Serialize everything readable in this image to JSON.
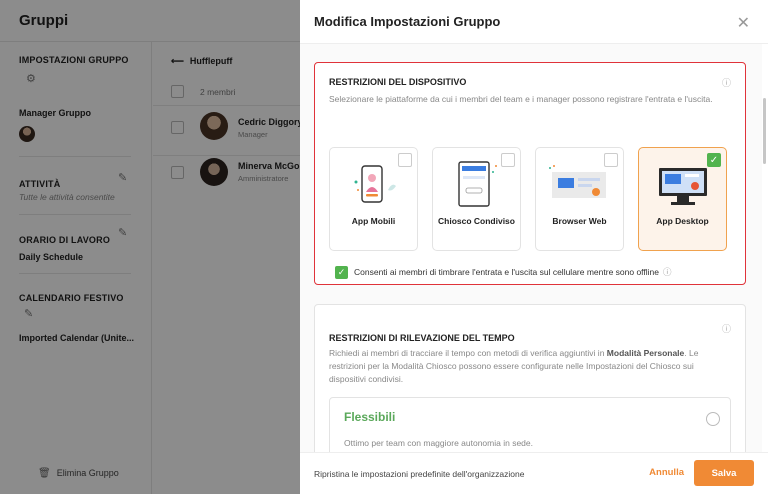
{
  "app": {
    "title": "Gruppi"
  },
  "sidebar": {
    "group_settings_heading": "IMPOSTAZIONI GRUPPO",
    "manager_label": "Manager Gruppo",
    "activities_heading": "ATTIVITÀ",
    "activities_value": "Tutte le attività consentite",
    "schedule_heading": "ORARIO DI LAVORO",
    "schedule_value": "Daily Schedule",
    "holiday_heading": "CALENDARIO FESTIVO",
    "holiday_value": "Imported Calendar (Unite...",
    "delete_label": "Elimina Gruppo"
  },
  "group": {
    "back_label": "Hufflepuff",
    "members_count": "2 membri",
    "members": [
      {
        "name": "Cedric Diggory",
        "role": "Manager"
      },
      {
        "name": "Minerva McGor",
        "role": "Amministratore"
      }
    ]
  },
  "drawer": {
    "title": "Modifica Impostazioni Gruppo",
    "device": {
      "heading": "RESTRIZIONI DEL DISPOSITIVO",
      "description": "Selezionare le piattaforme da cui i membri del team e i manager possono registrare l'entrata e l'uscita.",
      "options": [
        {
          "label": "App Mobili",
          "selected": false
        },
        {
          "label": "Chiosco Condiviso",
          "selected": false
        },
        {
          "label": "Browser Web",
          "selected": false
        },
        {
          "label": "App Desktop",
          "selected": true
        }
      ],
      "offline_label": "Consenti ai membri di timbrare l'entrata e l'uscita sul cellulare mentre sono offline",
      "offline_checked": true
    },
    "time": {
      "heading": "RESTRIZIONI DI RILEVAZIONE DEL TEMPO",
      "description_pre": "Richiedi ai membri di tracciare il tempo con metodi di verifica aggiuntivi in ",
      "description_bold": "Modalità Personale",
      "description_post": ". Le restrizioni per la Modalità Chiosco possono essere configurate nelle Impostazioni del Chiosco sui dispositivi condivisi.",
      "option_title": "Flessibili",
      "option_desc": "Ottimo per team con maggiore autonomia in sede."
    },
    "footer": {
      "reset_label": "Ripristina le impostazioni predefinite dell'organizzazione",
      "cancel_label": "Annulla",
      "save_label": "Salva"
    }
  },
  "colors": {
    "accent": "#f08a35",
    "check": "#52b34e",
    "active_border": "#e0333a",
    "flex_green": "#5aa85a"
  },
  "icons": [
    "arrow-left-icon",
    "gear-icon",
    "pencil-icon",
    "trash-icon",
    "close-icon",
    "info-icon",
    "checkmark-icon"
  ]
}
